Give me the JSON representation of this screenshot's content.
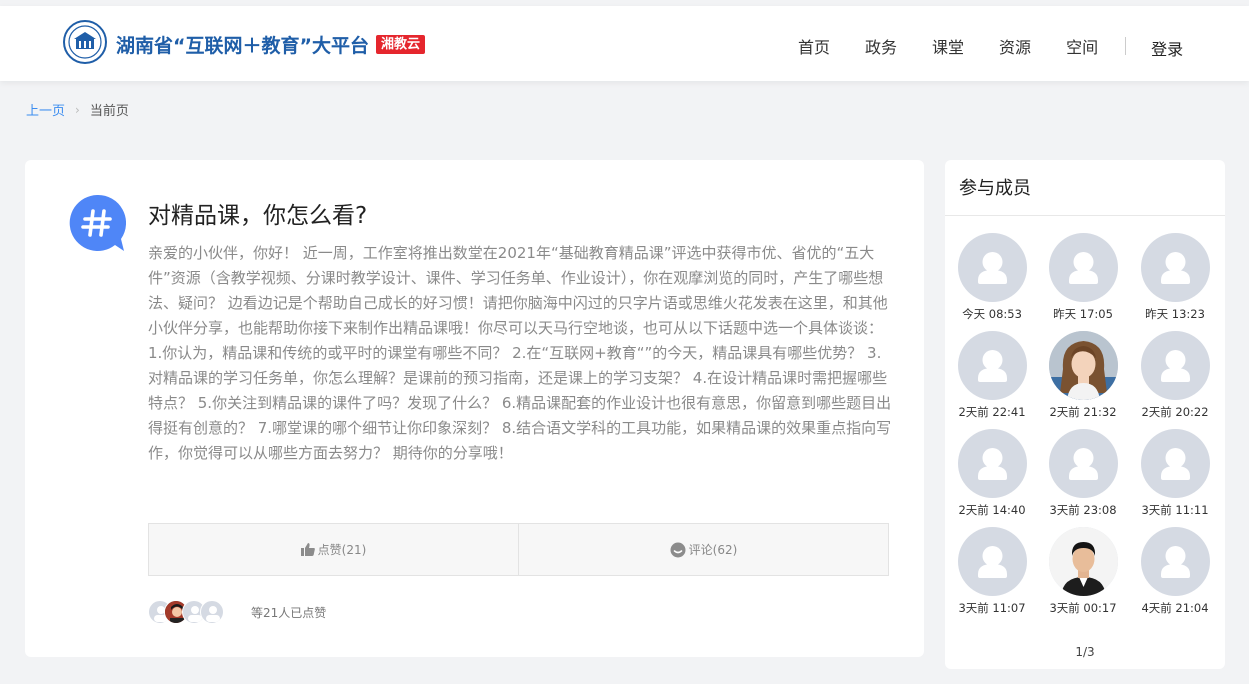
{
  "header": {
    "brand_title": "湖南省“互联网＋教育”大平台",
    "brand_badge": "湘教云",
    "nav": [
      "首页",
      "政务",
      "课堂",
      "资源",
      "空间"
    ],
    "login": "登录"
  },
  "breadcrumb": {
    "back": "上一页",
    "current": "当前页"
  },
  "topic": {
    "title": "对精品课，你怎么看?",
    "body": "亲爱的小伙伴，你好！ 近一周，工作室将推出数堂在2021年“基础教育精品课”评选中获得市优、省优的“五大件”资源（含教学视频、分课时教学设计、课件、学习任务单、作业设计），你在观摩浏览的同时，产生了哪些想法、疑问？ 边看边记是个帮助自己成长的好习惯！请把你脑海中闪过的只字片语或思维火花发表在这里，和其他小伙伴分享，也能帮助你接下来制作出精品课哦！你尽可以天马行空地谈，也可从以下话题中选一个具体谈谈： 1.你认为，精品课和传统的或平时的课堂有哪些不同？ 2.在“互联网+教育“”的今天，精品课具有哪些优势？ 3.对精品课的学习任务单，你怎么理解？是课前的预习指南，还是课上的学习支架？ 4.在设计精品课时需把握哪些特点？ 5.你关注到精品课的课件了吗？发现了什么？ 6.精品课配套的作业设计也很有意思，你留意到哪些题目出得挺有创意的？ 7.哪堂课的哪个细节让你印象深刻？ 8.结合语文学科的工具功能，如果精品课的效果重点指向写作，你觉得可以从哪些方面去努力？ 期待你的分享哦！",
    "like_label": "点赞(21)",
    "comment_label": "评论(62)",
    "likers_text": "等21人已点赞"
  },
  "members": {
    "title": "参与成员",
    "items": [
      {
        "time": "今天 08:53",
        "photo": false
      },
      {
        "time": "昨天 17:05",
        "photo": false
      },
      {
        "time": "昨天 13:23",
        "photo": false
      },
      {
        "time": "2天前 22:41",
        "photo": false
      },
      {
        "time": "2天前 21:32",
        "photo": "female"
      },
      {
        "time": "2天前 20:22",
        "photo": false
      },
      {
        "time": "2天前 14:40",
        "photo": false
      },
      {
        "time": "3天前 23:08",
        "photo": false
      },
      {
        "time": "3天前 11:11",
        "photo": false
      },
      {
        "time": "3天前 11:07",
        "photo": false
      },
      {
        "time": "3天前 00:17",
        "photo": "male"
      },
      {
        "time": "4天前 21:04",
        "photo": false
      }
    ],
    "pager": "1/3"
  },
  "colors": {
    "brand_blue": "#1f5ea8",
    "badge_red": "#e5262d",
    "link_blue": "#3b8cf0",
    "topic_icon_blue": "#4f86f7",
    "avatar_gray": "#d5dae3"
  }
}
